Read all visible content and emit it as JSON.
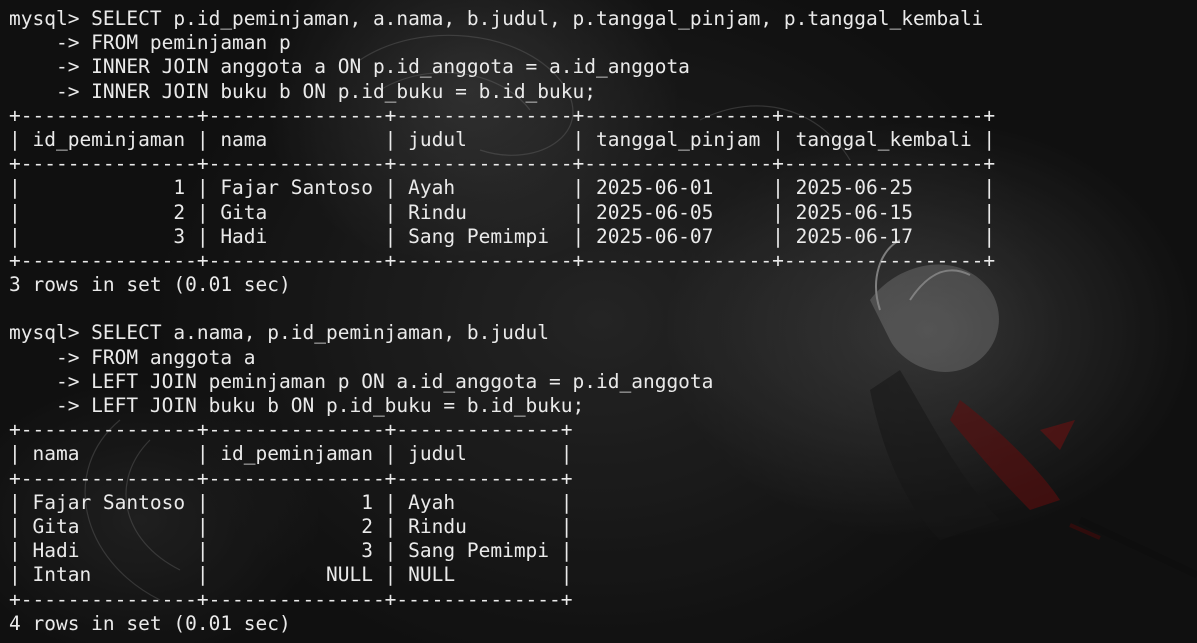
{
  "terminal": {
    "lines": [
      "mysql> SELECT p.id_peminjaman, a.nama, b.judul, p.tanggal_pinjam, p.tanggal_kembali",
      "    -> FROM peminjaman p",
      "    -> INNER JOIN anggota a ON p.id_anggota = a.id_anggota",
      "    -> INNER JOIN buku b ON p.id_buku = b.id_buku;",
      "+---------------+---------------+---------------+----------------+-----------------+",
      "| id_peminjaman | nama          | judul         | tanggal_pinjam | tanggal_kembali |",
      "+---------------+---------------+---------------+----------------+-----------------+",
      "|             1 | Fajar Santoso | Ayah          | 2025-06-01     | 2025-06-25      |",
      "|             2 | Gita          | Rindu         | 2025-06-05     | 2025-06-15      |",
      "|             3 | Hadi          | Sang Pemimpi  | 2025-06-07     | 2025-06-17      |",
      "+---------------+---------------+---------------+----------------+-----------------+",
      "3 rows in set (0.01 sec)",
      "",
      "mysql> SELECT a.nama, p.id_peminjaman, b.judul",
      "    -> FROM anggota a",
      "    -> LEFT JOIN peminjaman p ON a.id_anggota = p.id_anggota",
      "    -> LEFT JOIN buku b ON p.id_buku = b.id_buku;",
      "+---------------+---------------+--------------+",
      "| nama          | id_peminjaman | judul        |",
      "+---------------+---------------+--------------+",
      "| Fajar Santoso |             1 | Ayah         |",
      "| Gita          |             2 | Rindu        |",
      "| Hadi          |             3 | Sang Pemimpi |",
      "| Intan         |          NULL | NULL         |",
      "+---------------+---------------+--------------+",
      "4 rows in set (0.01 sec)"
    ]
  }
}
